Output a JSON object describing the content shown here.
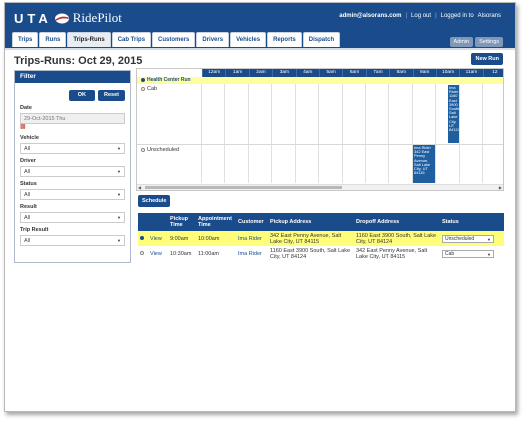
{
  "header": {
    "logo_uta": "UTA",
    "logo_ridepilot": "RidePilot",
    "user_email": "admin@alsorans.com",
    "logout": "Log out",
    "logged_in": "Logged in to",
    "provider": "Alsorans"
  },
  "nav": {
    "tabs": [
      "Trips",
      "Runs",
      "Trips-Runs",
      "Cab Trips",
      "Customers",
      "Drivers",
      "Vehicles",
      "Reports",
      "Dispatch"
    ],
    "active": "Trips-Runs",
    "admin": "Admin",
    "settings": "Settings"
  },
  "page": {
    "title": "Trips-Runs: Oct 29, 2015",
    "new_run": "New Run"
  },
  "filter": {
    "title": "Filter",
    "ok": "OK",
    "reset": "Reset",
    "date_label": "Date",
    "date_value": "29-Oct-2015 Thu",
    "calendar_icon": "calendar-icon",
    "vehicle_label": "Vehicle",
    "vehicle_value": "All",
    "driver_label": "Driver",
    "driver_value": "All",
    "status_label": "Status",
    "status_value": "All",
    "result_label": "Result",
    "result_value": "All",
    "trip_result_label": "Trip Result",
    "trip_result_value": "All"
  },
  "schedule": {
    "hours": [
      "12am",
      "1am",
      "2am",
      "3am",
      "4am",
      "5am",
      "6am",
      "7am",
      "8am",
      "9am",
      "10am",
      "11am",
      "12"
    ],
    "rows": [
      {
        "label": "Health Center Run",
        "selected": true
      },
      {
        "label": "Cab",
        "selected": false
      },
      {
        "label": "Unscheduled",
        "selected": false
      }
    ],
    "trip_blocks": [
      {
        "row": "Cab",
        "text": "Ima Rider 1160 East 3900 South, Salt Lake City, UT 84124"
      },
      {
        "row": "Unscheduled",
        "text": "Ima Rider 342 East Penny Avenue, Salt Lake City, UT 84115"
      }
    ],
    "schedule_button": "Schedule"
  },
  "trips_table": {
    "columns": [
      "",
      "",
      "Pickup Time",
      "Appointment Time",
      "Customer",
      "Pickup Address",
      "Dropoff Address",
      "Status"
    ],
    "rows": [
      {
        "selected": true,
        "view": "View",
        "pickup": "9:00am",
        "appointment": "10:00am",
        "customer": "Ima Rider",
        "pickup_address": "342 East Penny Avenue, Salt Lake City, UT 84115",
        "dropoff_address": "1160 East 3900 South, Salt Lake City, UT 84124",
        "status": "Unscheduled"
      },
      {
        "selected": false,
        "view": "View",
        "pickup": "10:30am",
        "appointment": "11:00am",
        "customer": "Ima Rider",
        "pickup_address": "1160 East 3900 South, Salt Lake City, UT 84124",
        "dropoff_address": "342 East Penny Avenue, Salt Lake City, UT 84115",
        "status": "Cab"
      }
    ]
  },
  "colors": {
    "brand_blue": "#1a4c8c",
    "highlight_yellow": "#fffe7a"
  }
}
